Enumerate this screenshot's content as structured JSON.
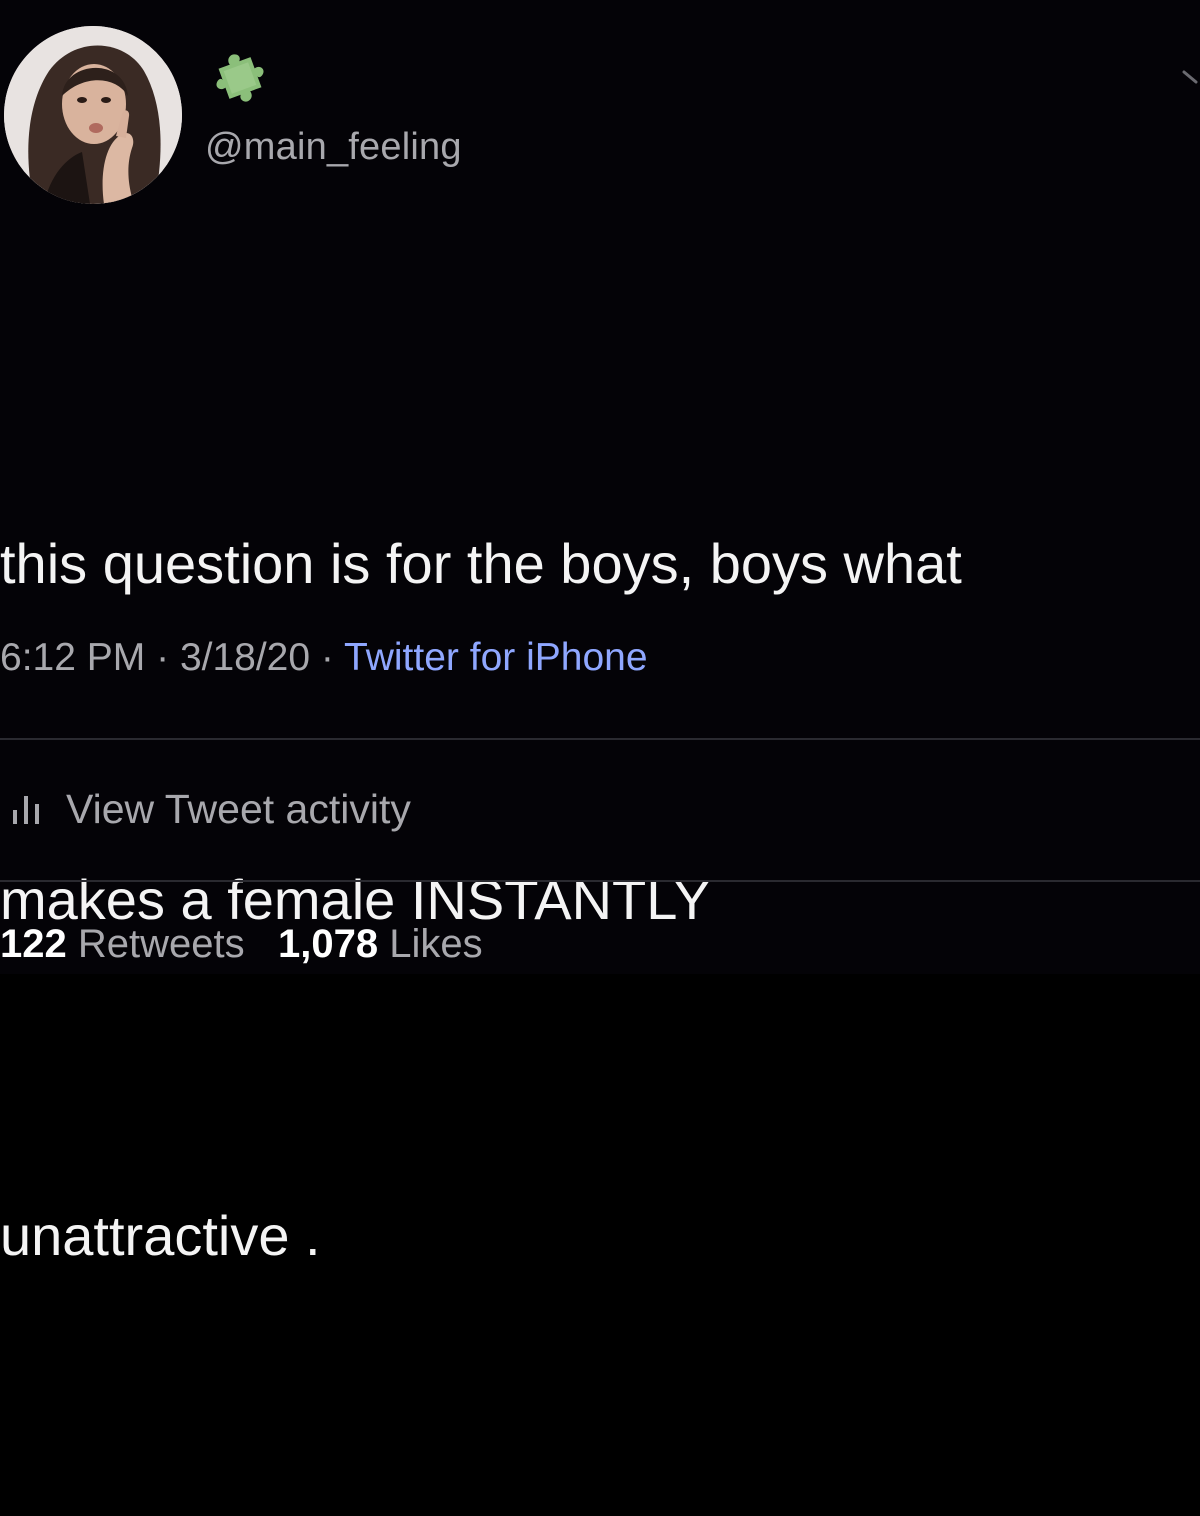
{
  "tweet": {
    "handle": "@main_feeling",
    "name_emoji": "puzzle-piece-emoji",
    "text_lines": [
      "this question is for the boys, boys what",
      "makes a female INSTANTLY",
      "unattractive ."
    ],
    "time": "6:12 PM",
    "date": "3/18/20",
    "source": "Twitter for iPhone",
    "separator": "·"
  },
  "activity": {
    "label": "View Tweet activity",
    "icon": "bar-chart-icon"
  },
  "stats": {
    "retweets_count": "122",
    "retweets_label": "Retweets",
    "likes_count": "1,078",
    "likes_label": "Likes"
  },
  "colors": {
    "background": "#040307",
    "text": "#f4f4f4",
    "secondary": "#a8a8ad",
    "link": "#8fa7ff",
    "divider": "#2a2a30",
    "puzzle": "#8bbf7a"
  }
}
